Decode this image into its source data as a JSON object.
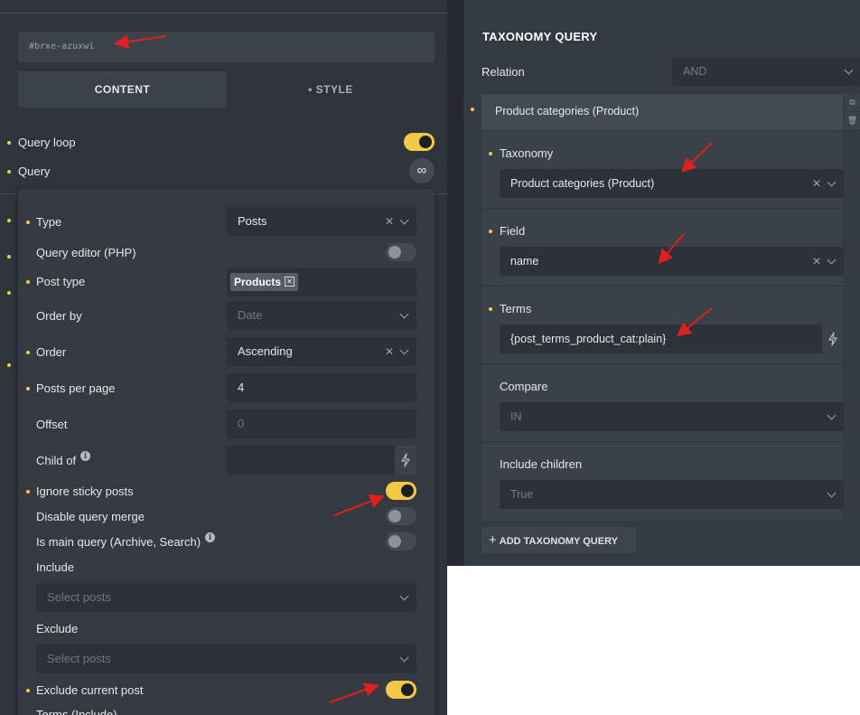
{
  "left": {
    "element_id": "#brxe-azuxwi",
    "tabs": {
      "content": "CONTENT",
      "style": "• STYLE"
    },
    "query_loop_label": "Query loop",
    "query_label": "Query",
    "infinity_symbol": "∞",
    "query": {
      "type_label": "Type",
      "type_value": "Posts",
      "query_editor_label": "Query editor (PHP)",
      "post_type_label": "Post type",
      "post_type_tag": "Products",
      "order_by_label": "Order by",
      "order_by_value": "Date",
      "order_label": "Order",
      "order_value": "Ascending",
      "posts_per_page_label": "Posts per page",
      "posts_per_page_value": "4",
      "offset_label": "Offset",
      "offset_placeholder": "0",
      "child_of_label": "Child of",
      "ignore_sticky_label": "Ignore sticky posts",
      "disable_merge_label": "Disable query merge",
      "is_main_query_label": "Is main query (Archive, Search)",
      "include_label": "Include",
      "include_placeholder": "Select posts",
      "exclude_label": "Exclude",
      "exclude_placeholder": "Select posts",
      "exclude_current_label": "Exclude current post",
      "terms_include_label": "Terms (Include)"
    },
    "toggles": {
      "query_loop": true,
      "query_editor": false,
      "ignore_sticky": true,
      "disable_merge": false,
      "is_main_query": false,
      "exclude_current": true
    }
  },
  "right": {
    "title": "TAXONOMY QUERY",
    "relation_label": "Relation",
    "relation_value": "AND",
    "item_title": "Product categories (Product)",
    "taxonomy_label": "Taxonomy",
    "taxonomy_value": "Product categories (Product)",
    "field_label": "Field",
    "field_value": "name",
    "terms_label": "Terms",
    "terms_value": "{post_terms_product_cat:plain}",
    "compare_label": "Compare",
    "compare_value": "IN",
    "include_children_label": "Include children",
    "include_children_value": "True",
    "add_button": "ADD TAXONOMY QUERY",
    "add_icon": "+"
  },
  "colors": {
    "accent": "#f6c945",
    "panel_bg": "#2f343b",
    "arrow": "#e02020"
  },
  "icons": [
    "infinity-icon",
    "chevron-down-icon",
    "clear-x-icon",
    "bolt-icon",
    "info-icon",
    "copy-icon",
    "trash-icon",
    "plus-icon"
  ]
}
